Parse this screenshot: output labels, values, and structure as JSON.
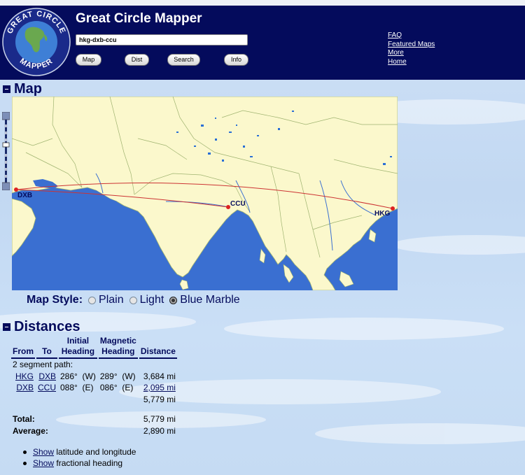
{
  "header": {
    "title": "Great Circle Mapper",
    "logo_text_top": "GREAT CIRCLE",
    "logo_text_bottom": "MAPPER",
    "search_value": "hkg-dxb-ccu",
    "buttons": [
      "Map",
      "Dist",
      "Search",
      "Info"
    ],
    "links": [
      "FAQ",
      "Featured Maps",
      "More",
      "Home"
    ]
  },
  "map_section": {
    "title": "Map",
    "airports": [
      {
        "code": "DXB"
      },
      {
        "code": "CCU"
      },
      {
        "code": "HKG"
      }
    ],
    "map_style": {
      "label": "Map Style:",
      "options": [
        "Plain",
        "Light",
        "Blue Marble"
      ],
      "selected": "Blue Marble"
    }
  },
  "distances_section": {
    "title": "Distances",
    "columns": {
      "from": "From",
      "to": "To",
      "initial_1": "Initial",
      "initial_2": "Heading",
      "magnetic_1": "Magnetic",
      "magnetic_2": "Heading",
      "distance": "Distance"
    },
    "segment_label": "2 segment path:",
    "rows": [
      {
        "from": "HKG",
        "to": "DXB",
        "init": "286°",
        "init_dir": "(W)",
        "mag": "289°",
        "mag_dir": "(W)",
        "distance": "3,684 mi"
      },
      {
        "from": "DXB",
        "to": "CCU",
        "init": "088°",
        "init_dir": "(E)",
        "mag": "086°",
        "mag_dir": "(E)",
        "distance": "2,095 mi"
      }
    ],
    "path_total": "5,779 mi",
    "total_label": "Total:",
    "total_value": "5,779 mi",
    "average_label": "Average:",
    "average_value": "2,890 mi",
    "options": [
      {
        "link": "Show",
        "text": "latitude and longitude"
      },
      {
        "link": "Show",
        "text": "fractional heading"
      }
    ]
  }
}
